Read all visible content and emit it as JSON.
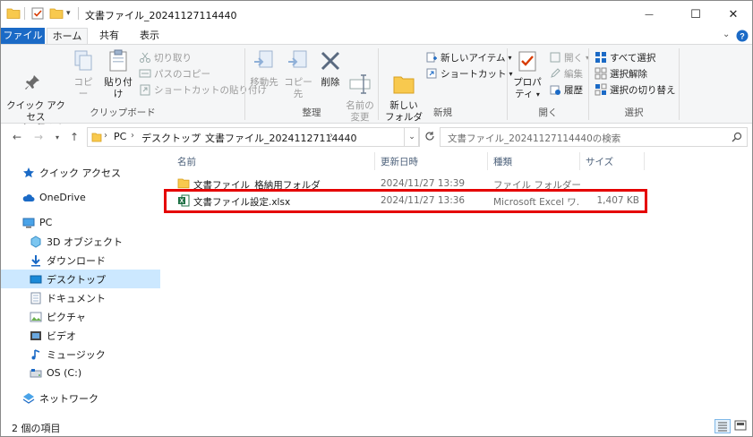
{
  "window": {
    "title": "文書ファイル_20241127114440",
    "minimize_glyph": "—",
    "maximize_glyph": "☐",
    "close_glyph": "✕"
  },
  "ribbon_tabs": [
    {
      "label": "ファイル"
    },
    {
      "label": "ホーム"
    },
    {
      "label": "共有"
    },
    {
      "label": "表示"
    }
  ],
  "ribbon": {
    "clipboard": {
      "label": "クリップボード",
      "pin": "クイック アクセス\nにピン留めする",
      "copy": "コピー",
      "paste": "貼り付け",
      "cut": "切り取り",
      "copy_path": "パスのコピー",
      "paste_shortcut": "ショートカットの貼り付け"
    },
    "organize": {
      "label": "整理",
      "move_to": "移動先",
      "copy_to": "コピー先",
      "delete": "削除",
      "rename": "名前の\n変更"
    },
    "new": {
      "label": "新規",
      "new_folder": "新しい\nフォルダー",
      "new_item": "新しいアイテム",
      "easy_access": "ショートカット"
    },
    "open": {
      "label": "開く",
      "properties": "プロパティ",
      "open": "開く",
      "edit": "編集",
      "history": "履歴"
    },
    "select": {
      "label": "選択",
      "select_all": "すべて選択",
      "select_none": "選択解除",
      "invert": "選択の切り替え"
    }
  },
  "address": {
    "crumbs": [
      "PC",
      "デスクトップ",
      "文書ファイル_20241127114440"
    ],
    "search_placeholder": "文書ファイル_20241127114440の検索"
  },
  "nav_pane": [
    {
      "label": "クイック アクセス",
      "icon": "star-icon"
    },
    {
      "label": "OneDrive",
      "icon": "cloud-icon"
    },
    {
      "label": "PC",
      "icon": "pc-icon"
    },
    {
      "label": "3D オブジェクト",
      "icon": "cube-icon"
    },
    {
      "label": "ダウンロード",
      "icon": "download-icon"
    },
    {
      "label": "デスクトップ",
      "icon": "desktop-icon"
    },
    {
      "label": "ドキュメント",
      "icon": "document-icon"
    },
    {
      "label": "ピクチャ",
      "icon": "picture-icon"
    },
    {
      "label": "ビデオ",
      "icon": "video-icon"
    },
    {
      "label": "ミュージック",
      "icon": "music-icon"
    },
    {
      "label": "OS (C:)",
      "icon": "drive-icon"
    },
    {
      "label": "ネットワーク",
      "icon": "network-icon"
    }
  ],
  "columns": {
    "name": "名前",
    "date": "更新日時",
    "type": "種類",
    "size": "サイズ"
  },
  "files": [
    {
      "name": "文書ファイル_格納用フォルダ",
      "date": "2024/11/27 13:39",
      "type": "ファイル フォルダー",
      "size": "",
      "icon": "folder-icon"
    },
    {
      "name": "文書ファイル設定.xlsx",
      "date": "2024/11/27 13:36",
      "type": "Microsoft Excel ワ...",
      "size": "1,407 KB",
      "icon": "excel-icon"
    }
  ],
  "status": {
    "item_count": "2 個の項目"
  },
  "colors": {
    "accent": "#1b6ac6",
    "selection": "#cce8ff",
    "highlight_border": "#e50000",
    "folder": "#f8c94e"
  }
}
